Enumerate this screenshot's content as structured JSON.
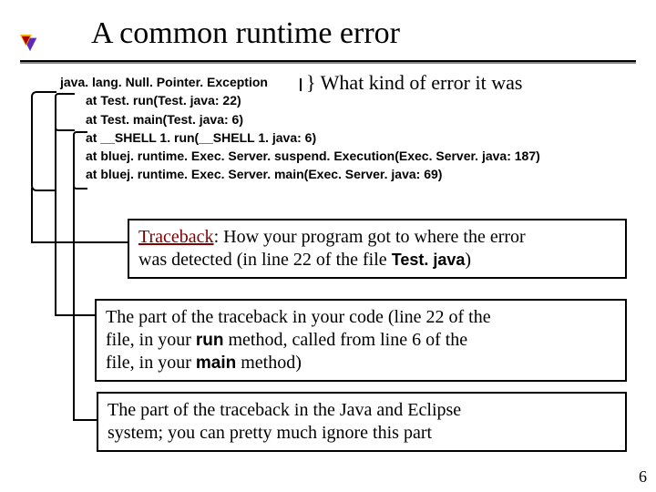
{
  "title": "A common runtime error",
  "stack": {
    "l0": "java. lang. Null. Pointer. Exception",
    "l1": "at Test. run(Test. java: 22)",
    "l2": "at Test. main(Test. java: 6)",
    "l3": "at __SHELL 1. run(__SHELL 1. java: 6)",
    "l4": "at bluej. runtime. Exec. Server. suspend. Execution(Exec. Server. java: 187)",
    "l5": "at bluej. runtime. Exec. Server. main(Exec. Server. java: 69)"
  },
  "annot_right": "} What kind of error it was",
  "box1": {
    "tb": "Traceback",
    "rest1": ": How your program got to where the error",
    "rest2": "was detected (in line 22 of the file ",
    "file": "Test. java",
    "tail": ")"
  },
  "box2": {
    "t1": "The part of the traceback in your code (line 22 of the",
    "t2a": "file, in your ",
    "run": "run",
    "t2b": " method, called from line 6 of the",
    "t3a": "file, in your ",
    "main": "main",
    "t3b": " method)"
  },
  "box3": {
    "t1": "The part of the traceback in the Java and Eclipse",
    "t2": "system; you can pretty much ignore this part"
  },
  "pagenum": "6"
}
